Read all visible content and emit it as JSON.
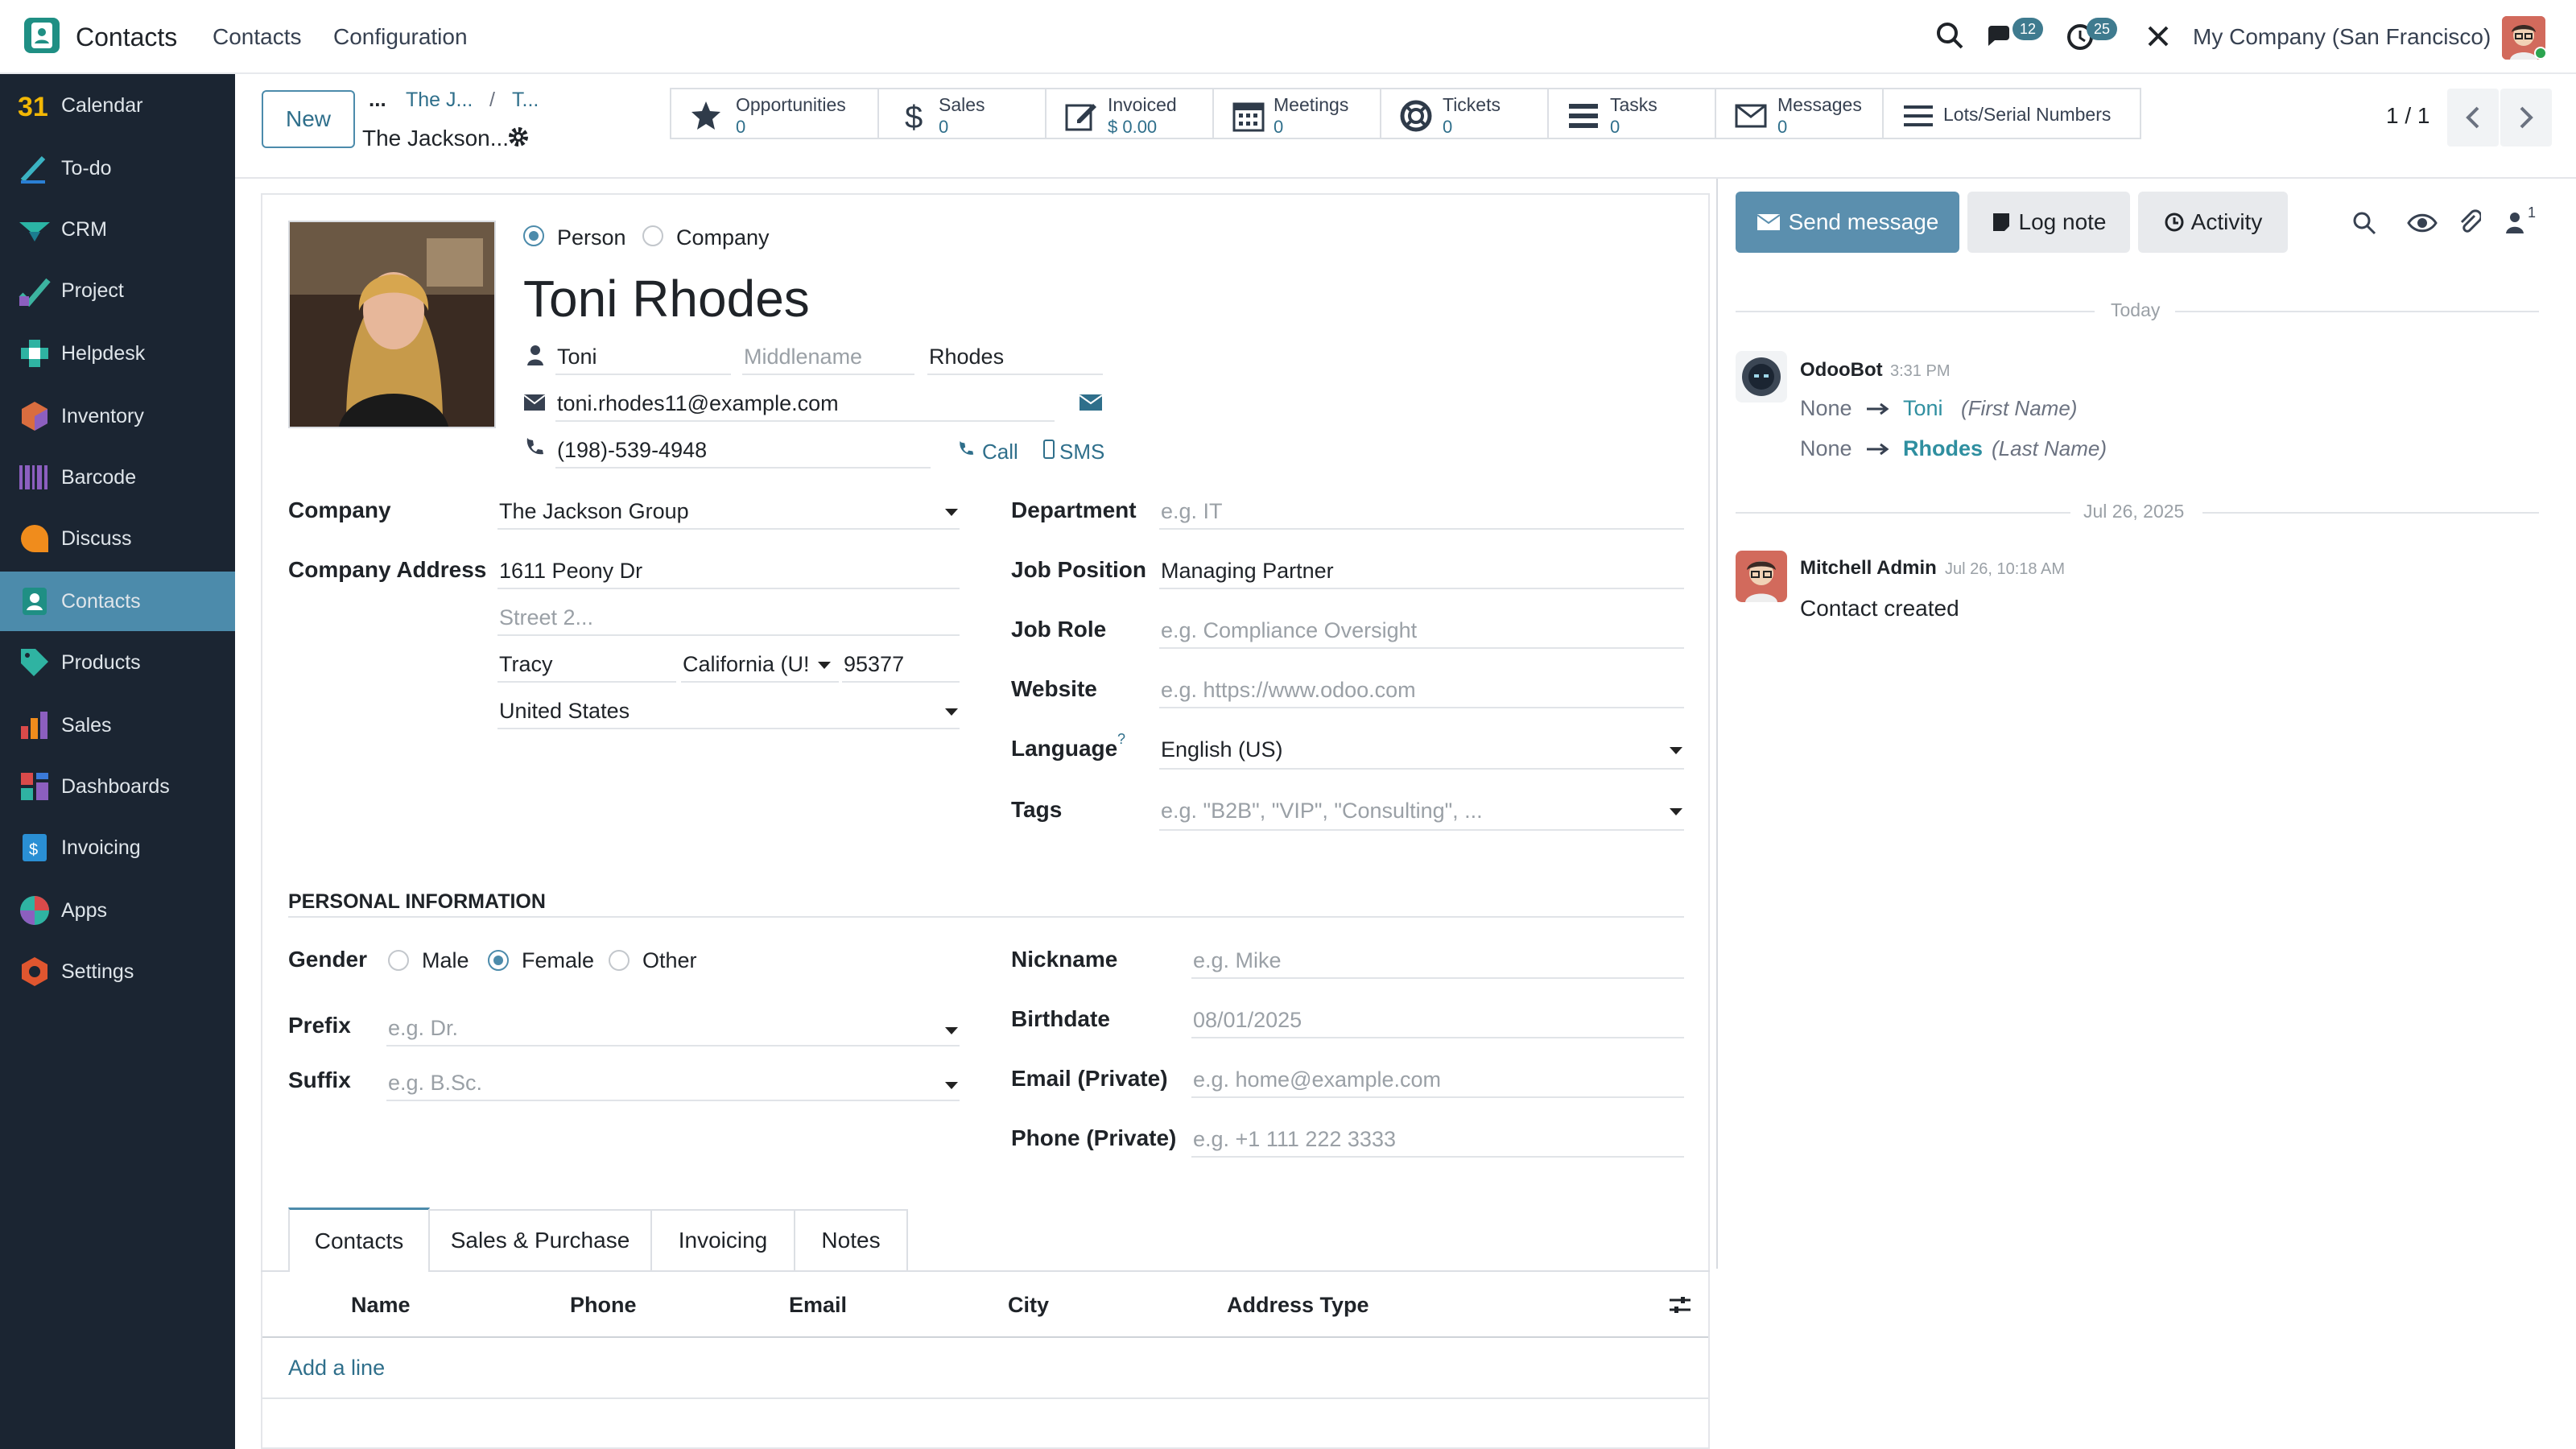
{
  "app": {
    "title": "Contacts"
  },
  "topnav": {
    "menu": [
      "Contacts",
      "Configuration"
    ],
    "messages_badge": "12",
    "activities_badge": "25",
    "company": "My Company (San Francisco)"
  },
  "sidebar": {
    "items": [
      {
        "label": "Calendar",
        "icon": "calendar-icon"
      },
      {
        "label": "To-do",
        "icon": "todo-icon"
      },
      {
        "label": "CRM",
        "icon": "crm-icon"
      },
      {
        "label": "Project",
        "icon": "project-icon"
      },
      {
        "label": "Helpdesk",
        "icon": "helpdesk-icon"
      },
      {
        "label": "Inventory",
        "icon": "inventory-icon"
      },
      {
        "label": "Barcode",
        "icon": "barcode-icon"
      },
      {
        "label": "Discuss",
        "icon": "discuss-icon"
      },
      {
        "label": "Contacts",
        "icon": "contacts-icon",
        "active": true
      },
      {
        "label": "Products",
        "icon": "products-icon"
      },
      {
        "label": "Sales",
        "icon": "sales-icon"
      },
      {
        "label": "Dashboards",
        "icon": "dashboards-icon"
      },
      {
        "label": "Invoicing",
        "icon": "invoicing-icon"
      },
      {
        "label": "Apps",
        "icon": "apps-icon"
      },
      {
        "label": "Settings",
        "icon": "settings-icon"
      }
    ]
  },
  "control": {
    "new_label": "New",
    "breadcrumb": {
      "ellipsis": "...",
      "crumb1": "The J...",
      "sep": "/",
      "crumb2": "T...",
      "current": "The Jackson..."
    },
    "pager": "1 / 1",
    "stats": [
      {
        "label": "Opportunities",
        "value": "0"
      },
      {
        "label": "Sales",
        "value": "0"
      },
      {
        "label": "Invoiced",
        "value": "$ 0.00"
      },
      {
        "label": "Meetings",
        "value": "0"
      },
      {
        "label": "Tickets",
        "value": "0"
      },
      {
        "label": "Tasks",
        "value": "0"
      },
      {
        "label": "Messages",
        "value": "0"
      },
      {
        "label": "Lots/Serial Numbers",
        "value": ""
      }
    ]
  },
  "form": {
    "type_person": "Person",
    "type_company": "Company",
    "name": "Toni Rhodes",
    "first_name": "Toni",
    "middle_placeholder": "Middlename",
    "last_name": "Rhodes",
    "email": "toni.rhodes11@example.com",
    "phone": "(198)-539-4948",
    "call_label": "Call",
    "sms_label": "SMS",
    "left_fields": {
      "company_label": "Company",
      "company_value": "The Jackson Group",
      "address_label": "Company Address",
      "street": "1611 Peony Dr",
      "street2_placeholder": "Street 2...",
      "city": "Tracy",
      "state": "California (U!",
      "zip": "95377",
      "country": "United States"
    },
    "right_fields": {
      "department_label": "Department",
      "department_placeholder": "e.g. IT",
      "job_position_label": "Job Position",
      "job_position_value": "Managing Partner",
      "job_role_label": "Job Role",
      "job_role_placeholder": "e.g. Compliance Oversight",
      "website_label": "Website",
      "website_placeholder": "e.g. https://www.odoo.com",
      "language_label": "Language",
      "language_help": "?",
      "language_value": "English (US)",
      "tags_label": "Tags",
      "tags_placeholder": "e.g. \"B2B\", \"VIP\", \"Consulting\", ..."
    },
    "personal": {
      "section_title": "PERSONAL INFORMATION",
      "gender_label": "Gender",
      "male": "Male",
      "female": "Female",
      "other": "Other",
      "prefix_label": "Prefix",
      "prefix_placeholder": "e.g. Dr.",
      "suffix_label": "Suffix",
      "suffix_placeholder": "e.g. B.Sc.",
      "nickname_label": "Nickname",
      "nickname_placeholder": "e.g. Mike",
      "birthdate_label": "Birthdate",
      "birthdate_placeholder": "08/01/2025",
      "email_private_label": "Email (Private)",
      "email_private_placeholder": "e.g. home@example.com",
      "phone_private_label": "Phone (Private)",
      "phone_private_placeholder": "e.g. +1 111 222 3333"
    },
    "tabs": [
      "Contacts",
      "Sales & Purchase",
      "Invoicing",
      "Notes"
    ],
    "table": {
      "columns": [
        "Name",
        "Phone",
        "Email",
        "City",
        "Address Type"
      ],
      "add_line": "Add a line"
    }
  },
  "chatter": {
    "send_message": "Send message",
    "log_note": "Log note",
    "activity": "Activity",
    "followers_count": "1",
    "date_today": "Today",
    "messages": [
      {
        "author": "OdooBot",
        "time": "3:31 PM",
        "changes": [
          {
            "old": "None",
            "new": "Toni",
            "field": "(First Name)"
          },
          {
            "old": "None",
            "new": "Rhodes",
            "field": "(Last Name)"
          }
        ]
      }
    ],
    "date_2": "Jul 26, 2025",
    "message2": {
      "author": "Mitchell Admin",
      "time": "Jul 26, 10:18 AM",
      "body": "Contact created"
    }
  },
  "colors": {
    "accent": "#4c8bab",
    "sidebar": "#1b2532",
    "link": "#2f6f8b"
  }
}
